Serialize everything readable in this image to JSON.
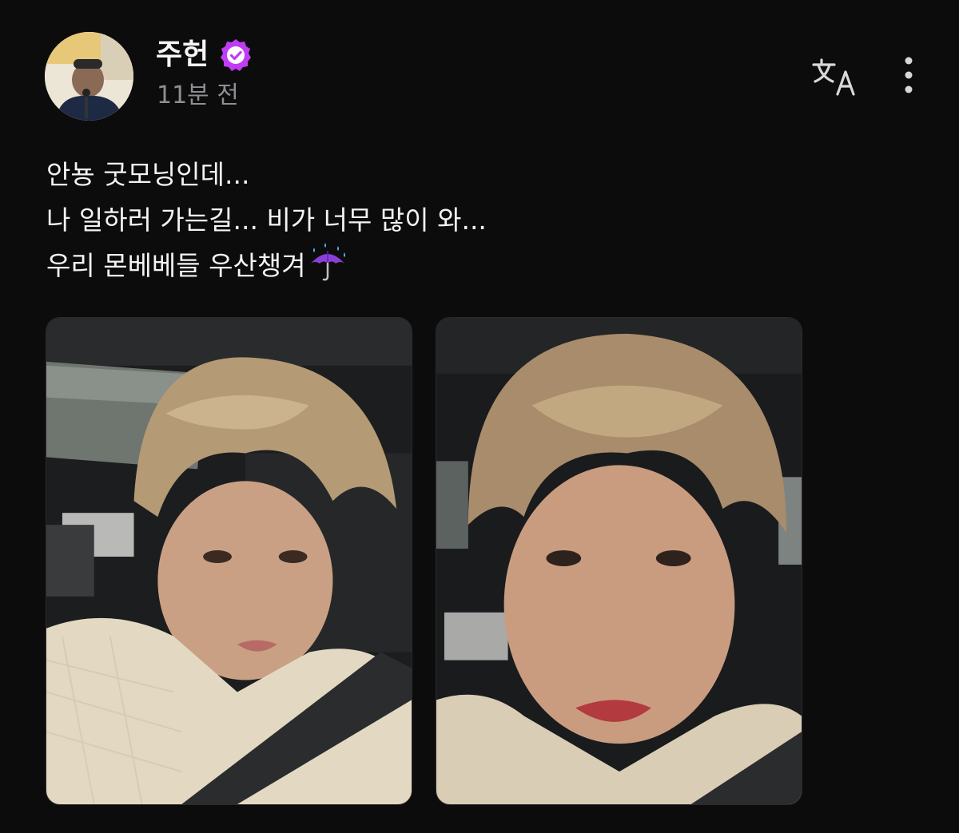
{
  "post": {
    "author": {
      "name": "주헌",
      "time": "11분 전",
      "verified_icon": "verified-badge-icon",
      "accent_color": "#c13cf5"
    },
    "text_lines": [
      "안뇽 굿모닝인데...",
      "나 일하러 가는길... 비가 너무 많이 와...",
      "우리 몬베베들 우산챙겨"
    ],
    "text_emoji": "umbrella-with-rain-icon",
    "actions": {
      "translate_icon": "translate-icon",
      "more_icon": "more-vertical-icon"
    },
    "photos": [
      {
        "icon": "selfie-photo-1"
      },
      {
        "icon": "selfie-photo-2"
      }
    ]
  }
}
